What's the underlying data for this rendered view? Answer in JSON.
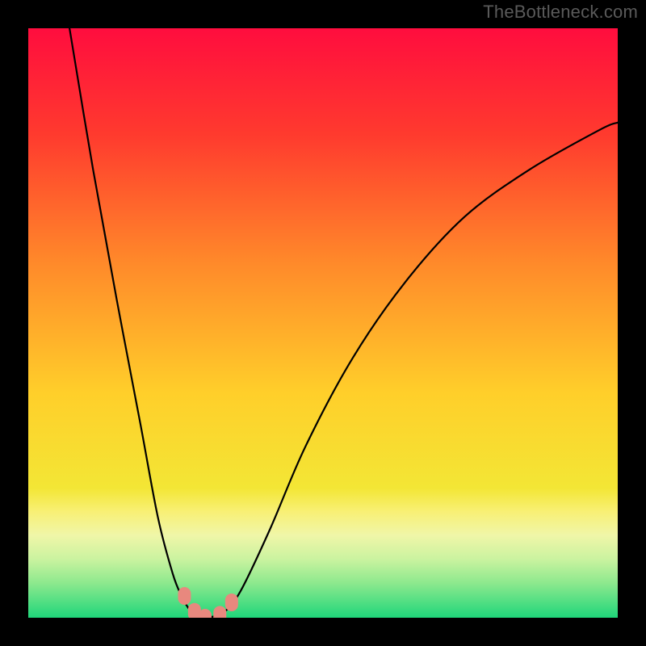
{
  "watermark": "TheBottleneck.com",
  "chart_data": {
    "type": "line",
    "title": "",
    "xlabel": "",
    "ylabel": "",
    "xlim": [
      0,
      100
    ],
    "ylim": [
      0,
      100
    ],
    "series": [
      {
        "name": "left-branch",
        "x": [
          7,
          11,
          15,
          19,
          22,
          24.5,
          26,
          27.5,
          29,
          30
        ],
        "y": [
          100,
          76,
          54,
          33,
          17,
          7.5,
          3.7,
          1.2,
          0.2,
          0
        ]
      },
      {
        "name": "right-branch",
        "x": [
          30,
          33,
          36,
          41,
          47,
          55,
          64,
          74,
          85,
          97,
          100
        ],
        "y": [
          0,
          0.8,
          4.5,
          15,
          29,
          44,
          57,
          68,
          76,
          82.8,
          84
        ]
      }
    ],
    "highlight_points": [
      {
        "x": 26.5,
        "y": 3.7
      },
      {
        "x": 28.2,
        "y": 1.0
      },
      {
        "x": 30.0,
        "y": 0.0
      },
      {
        "x": 32.5,
        "y": 0.5
      },
      {
        "x": 34.5,
        "y": 2.6
      }
    ],
    "highlight_color": "#e8887e",
    "background_gradient": {
      "stops": [
        {
          "pct": 0,
          "color": "#ff0d3e"
        },
        {
          "pct": 18,
          "color": "#ff3a2e"
        },
        {
          "pct": 40,
          "color": "#ff8a2a"
        },
        {
          "pct": 62,
          "color": "#ffcf2a"
        },
        {
          "pct": 78,
          "color": "#f3e635"
        },
        {
          "pct": 82,
          "color": "#f8f075"
        },
        {
          "pct": 86,
          "color": "#f0f6a8"
        },
        {
          "pct": 90,
          "color": "#cbf3a0"
        },
        {
          "pct": 94,
          "color": "#8fe98e"
        },
        {
          "pct": 100,
          "color": "#1fd67a"
        }
      ]
    },
    "bottom_bands": {
      "start_pct": 78,
      "colors": [
        "#f9f18a",
        "#faf4a8",
        "#f4f6b8",
        "#e8f4b4",
        "#d6f2a8",
        "#bfee9a",
        "#a7ea8e",
        "#8fe684",
        "#74e07c",
        "#58da77",
        "#3cd374",
        "#1fd67a"
      ]
    }
  }
}
